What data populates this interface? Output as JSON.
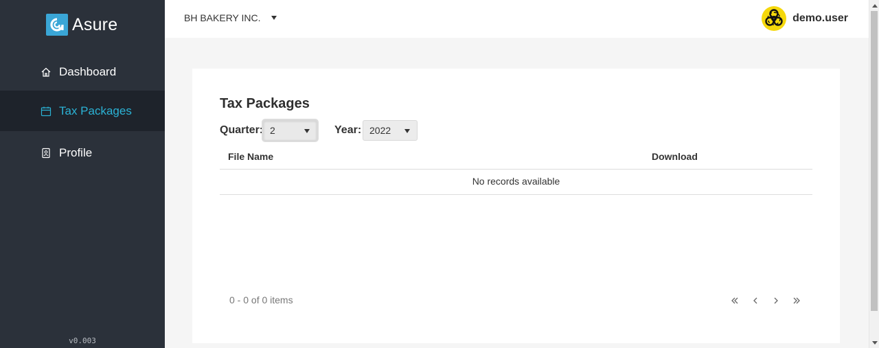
{
  "app": {
    "logo_text": "Asure",
    "version": "v0.003"
  },
  "sidebar": {
    "items": [
      {
        "label": "Dashboard",
        "icon": "home-icon",
        "active": false
      },
      {
        "label": "Tax Packages",
        "icon": "calendar-icon",
        "active": true
      },
      {
        "label": "Profile",
        "icon": "profile-icon",
        "active": false
      }
    ]
  },
  "header": {
    "company": "BH BAKERY INC.",
    "username": "demo.user",
    "avatar_icon": "biohazard-icon"
  },
  "main": {
    "title": "Tax Packages",
    "filters": {
      "quarter_label": "Quarter:",
      "quarter_value": "2",
      "year_label": "Year:",
      "year_value": "2022"
    },
    "grid": {
      "columns": [
        "File Name",
        "Download"
      ],
      "empty_text": "No records available"
    },
    "pager": {
      "info": "0 - 0 of 0 items",
      "buttons": [
        "first-page-icon",
        "prev-page-icon",
        "next-page-icon",
        "last-page-icon"
      ]
    }
  },
  "colors": {
    "sidebar_bg": "#2b313a",
    "sidebar_active_bg": "#1e232b",
    "accent": "#2bb3d6",
    "avatar_bg": "#f5d80c",
    "logo_bg": "#3aa6d6"
  }
}
